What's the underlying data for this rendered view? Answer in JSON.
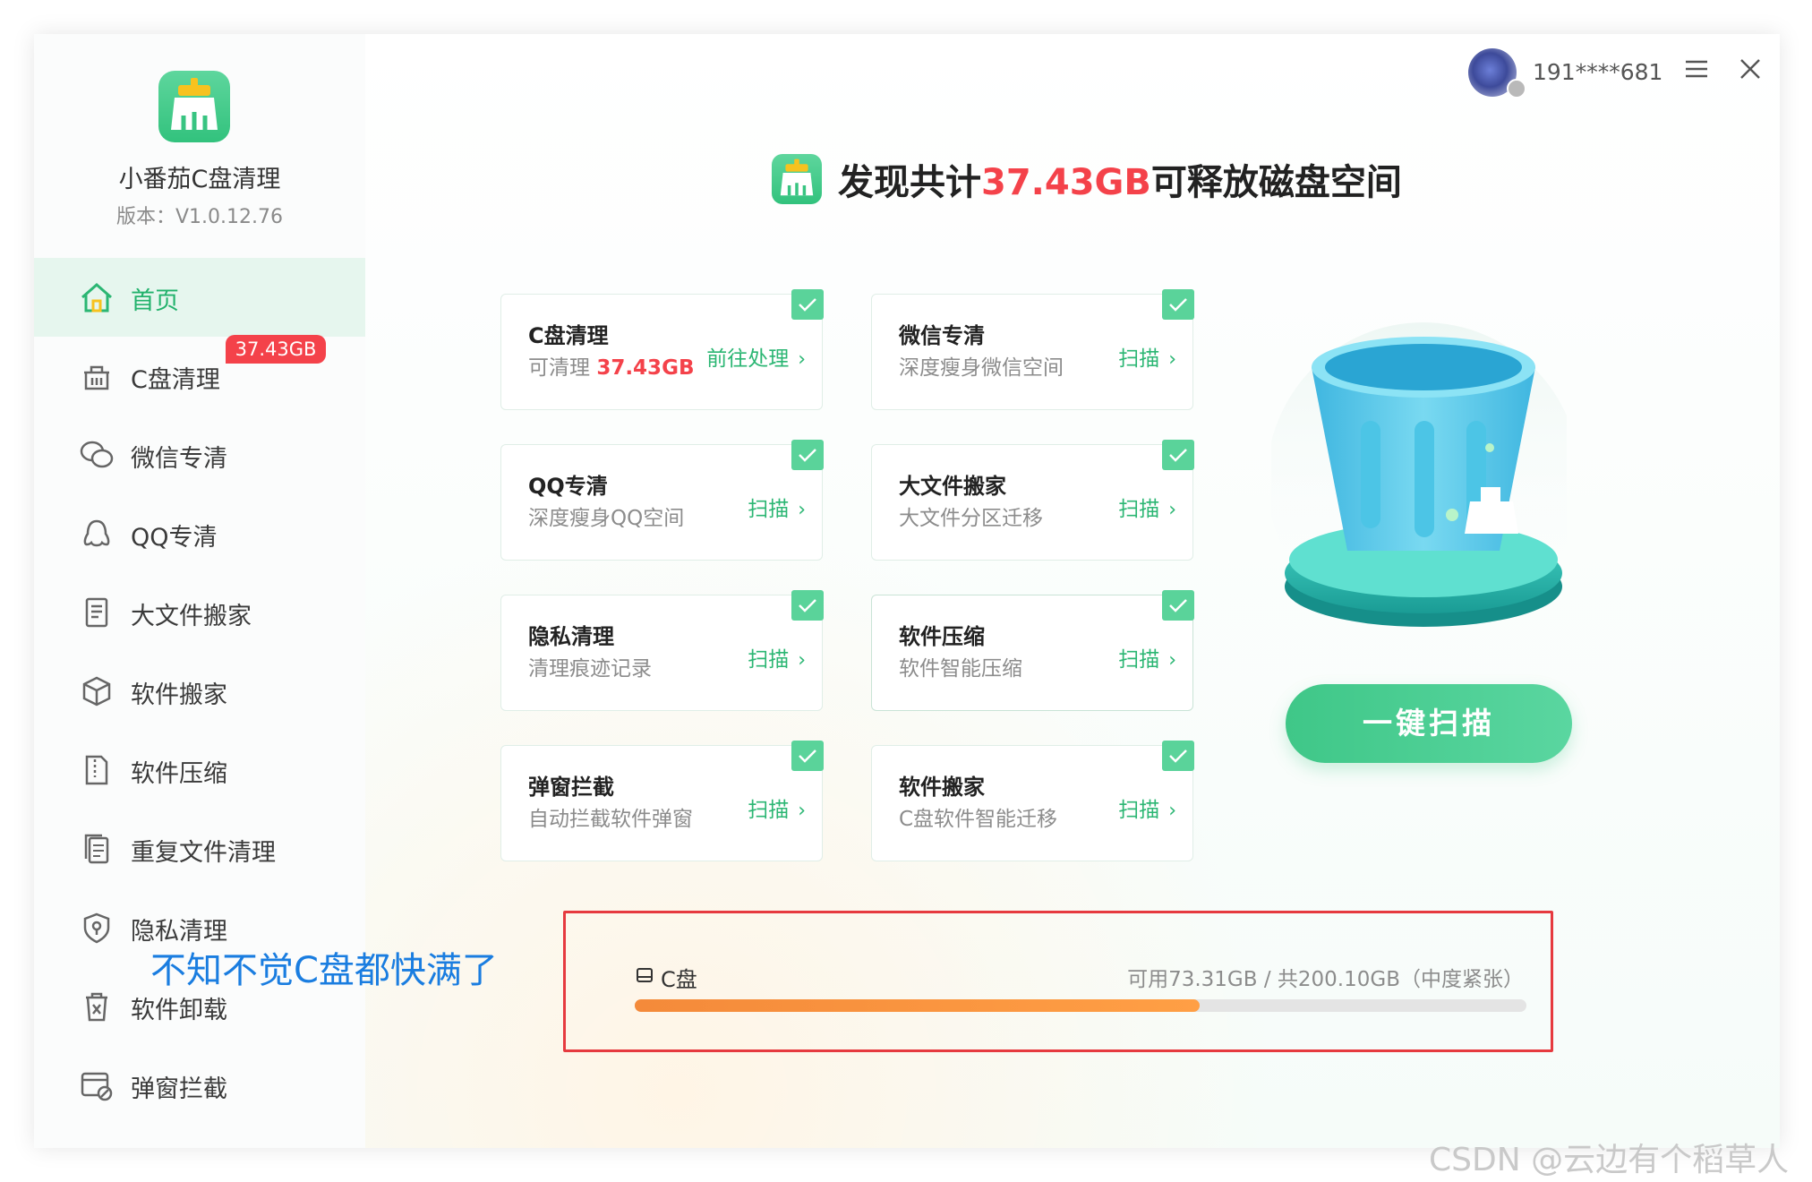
{
  "app": {
    "name": "小番茄C盘清理",
    "version": "版本：V1.0.12.76"
  },
  "sidebar": {
    "items": [
      {
        "label": "首页",
        "icon": "home-icon"
      },
      {
        "label": "C盘清理",
        "icon": "basket-icon"
      },
      {
        "label": "微信专清",
        "icon": "wechat-icon"
      },
      {
        "label": "QQ专清",
        "icon": "qq-icon"
      },
      {
        "label": "大文件搬家",
        "icon": "file-list-icon"
      },
      {
        "label": "软件搬家",
        "icon": "package-icon"
      },
      {
        "label": "软件压缩",
        "icon": "zip-icon"
      },
      {
        "label": "重复文件清理",
        "icon": "duplicate-icon"
      },
      {
        "label": "隐私清理",
        "icon": "shield-icon"
      },
      {
        "label": "软件卸载",
        "icon": "trash-icon"
      },
      {
        "label": "弹窗拦截",
        "icon": "popup-block-icon"
      }
    ],
    "badge": "37.43GB"
  },
  "annotation": "不知不觉C盘都快满了",
  "header": {
    "user": "191****681"
  },
  "headline": {
    "prefix": "发现共计",
    "amount": "37.43GB",
    "suffix": "可释放磁盘空间"
  },
  "cards": [
    {
      "title": "C盘清理",
      "desc_prefix": "可清理 ",
      "desc_amount": "37.43GB",
      "action": "前往处理"
    },
    {
      "title": "微信专清",
      "desc": "深度瘦身微信空间",
      "action": "扫描"
    },
    {
      "title": "QQ专清",
      "desc": "深度瘦身QQ空间",
      "action": "扫描"
    },
    {
      "title": "大文件搬家",
      "desc": "大文件分区迁移",
      "action": "扫描"
    },
    {
      "title": "隐私清理",
      "desc": "清理痕迹记录",
      "action": "扫描"
    },
    {
      "title": "软件压缩",
      "desc": "软件智能压缩",
      "action": "扫描"
    },
    {
      "title": "弹窗拦截",
      "desc": "自动拦截软件弹窗",
      "action": "扫描"
    },
    {
      "title": "软件搬家",
      "desc": "C盘软件智能迁移",
      "action": "扫描"
    }
  ],
  "scan_button": "一键扫描",
  "disk": {
    "name": "C盘",
    "free": "可用73.31GB",
    "sep": " / ",
    "total": "共200.10GB（中度紧张）",
    "used_percent": 63.4
  },
  "watermark": "CSDN @云边有个稻草人",
  "colors": {
    "accent": "#2bb673",
    "danger": "#f4424a",
    "progress": "#f48a3a"
  }
}
